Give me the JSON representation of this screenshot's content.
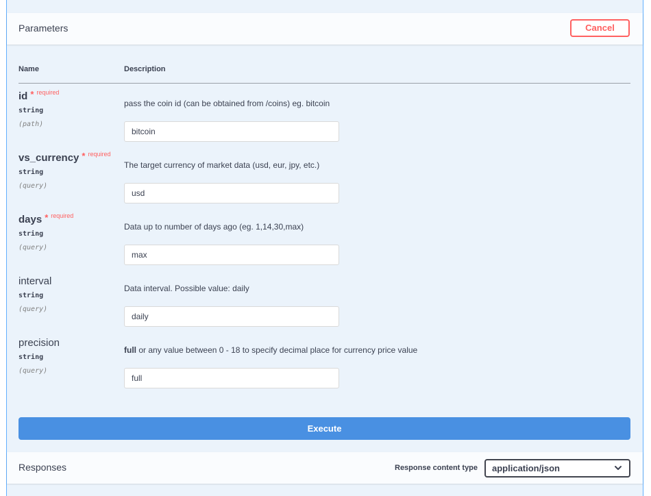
{
  "parameters": {
    "title": "Parameters",
    "cancel_label": "Cancel",
    "col_name": "Name",
    "col_description": "Description",
    "items": [
      {
        "name": "id",
        "required": true,
        "star": "*",
        "required_label": "required",
        "type": "string",
        "in": "(path)",
        "description": "pass the coin id (can be obtained from /coins) eg. bitcoin",
        "value": "bitcoin"
      },
      {
        "name": "vs_currency",
        "required": true,
        "star": "*",
        "required_label": "required",
        "type": "string",
        "in": "(query)",
        "description": "The target currency of market data (usd, eur, jpy, etc.)",
        "value": "usd"
      },
      {
        "name": "days",
        "required": true,
        "star": "*",
        "required_label": "required",
        "type": "string",
        "in": "(query)",
        "description": "Data up to number of days ago (eg. 1,14,30,max)",
        "value": "max"
      },
      {
        "name": "interval",
        "required": false,
        "type": "string",
        "in": "(query)",
        "description": "Data interval. Possible value: daily",
        "value": "daily"
      },
      {
        "name": "precision",
        "required": false,
        "type": "string",
        "in": "(query)",
        "description_bold": "full",
        "description": " or any value between 0 - 18 to specify decimal place for currency price value",
        "value": "full"
      }
    ]
  },
  "execute_label": "Execute",
  "responses": {
    "title": "Responses",
    "content_type_label": "Response content type",
    "content_type_value": "application/json"
  },
  "icons": {
    "select": "chevron-down-icon"
  },
  "colors": {
    "panel_bg": "#ebf3fb",
    "accent_border": "#61affe",
    "cancel": "#ff6060",
    "execute": "#4990e2",
    "required": "#ff6060"
  }
}
